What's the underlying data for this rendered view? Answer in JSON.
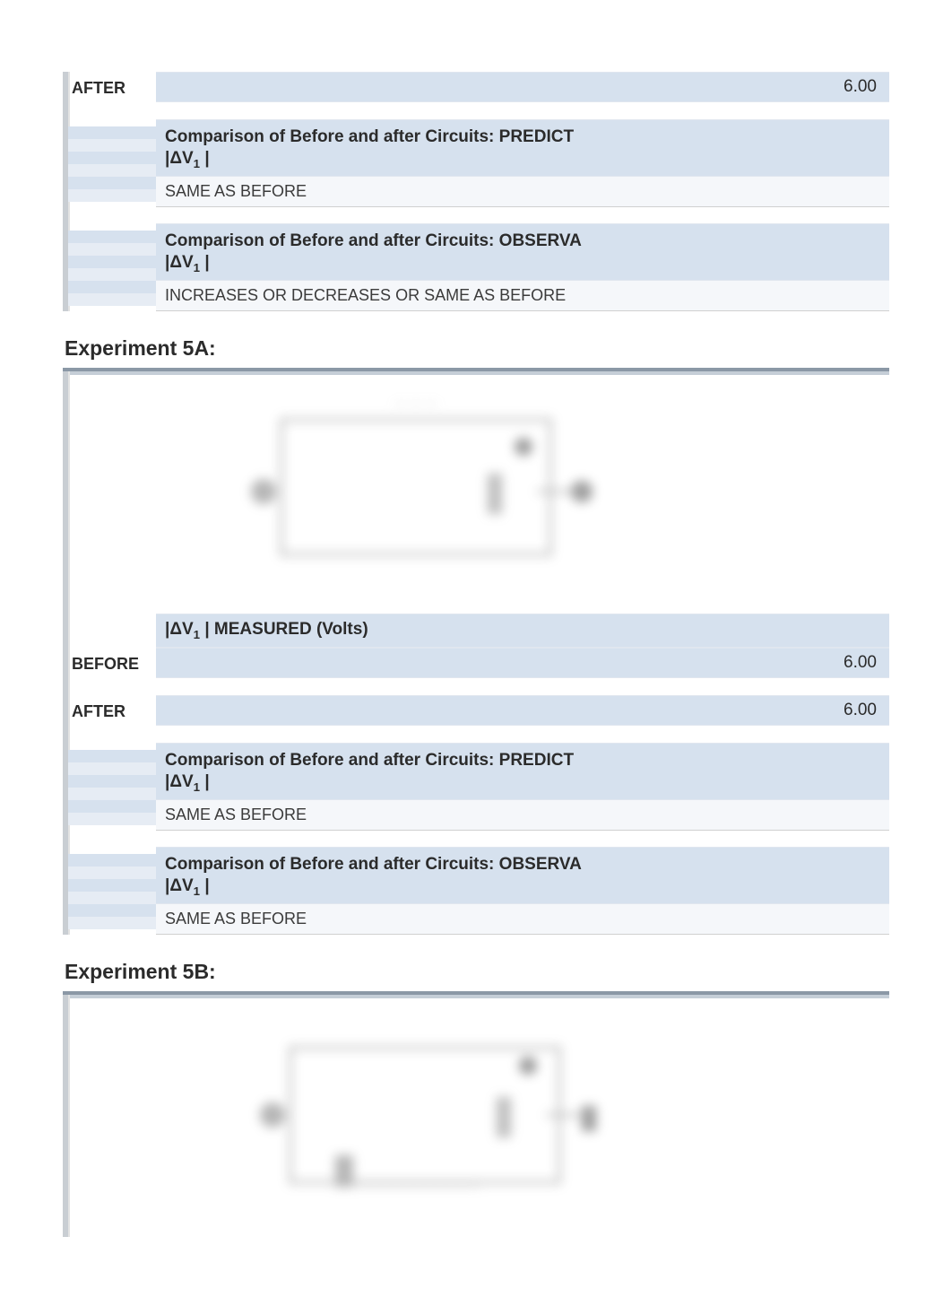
{
  "section_top": {
    "after_label": "AFTER",
    "after_value": "6.00",
    "predict_header_prefix": "Comparison of Before and after Circuits:  PREDICT",
    "observe_header_prefix": "Comparison of Before and after Circuits:  OBSERVA",
    "dv1_label": "|ΔV1 |",
    "predict_answer": "SAME AS BEFORE",
    "observe_answer": "INCREASES OR DECREASES OR SAME AS BEFORE"
  },
  "exp5a": {
    "title": "Experiment 5A:",
    "measured_header": "|ΔV1 | MEASURED (Volts)",
    "before_label": "BEFORE",
    "before_value": "6.00",
    "after_label": "AFTER",
    "after_value": "6.00",
    "predict_header_prefix": "Comparison of Before and after Circuits:  PREDICT",
    "observe_header_prefix": "Comparison of Before and after Circuits:  OBSERVA",
    "dv1_label": "|ΔV1 |",
    "predict_answer": "SAME AS BEFORE",
    "observe_answer": "SAME AS BEFORE"
  },
  "exp5b": {
    "title": "Experiment 5B:"
  }
}
